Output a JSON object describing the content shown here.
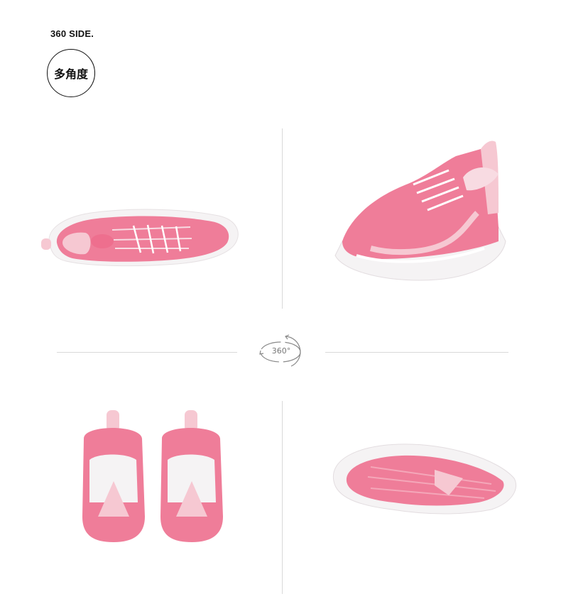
{
  "header": {
    "title": "360 SIDE.",
    "badge": "多角度"
  },
  "center_icon": {
    "label": "360°",
    "icon": "rotate-360-icon"
  },
  "product_views": [
    {
      "view": "top",
      "icon": "shoe-top-view"
    },
    {
      "view": "side",
      "icon": "shoe-side-view"
    },
    {
      "view": "back",
      "icon": "shoe-back-view"
    },
    {
      "view": "sole",
      "icon": "shoe-sole-view"
    }
  ],
  "colors": {
    "shoe_pink": "#ef7d99",
    "shoe_light_pink": "#f6c8d2",
    "sole_white": "#f5f3f4",
    "divider": "#d9d9d9"
  }
}
